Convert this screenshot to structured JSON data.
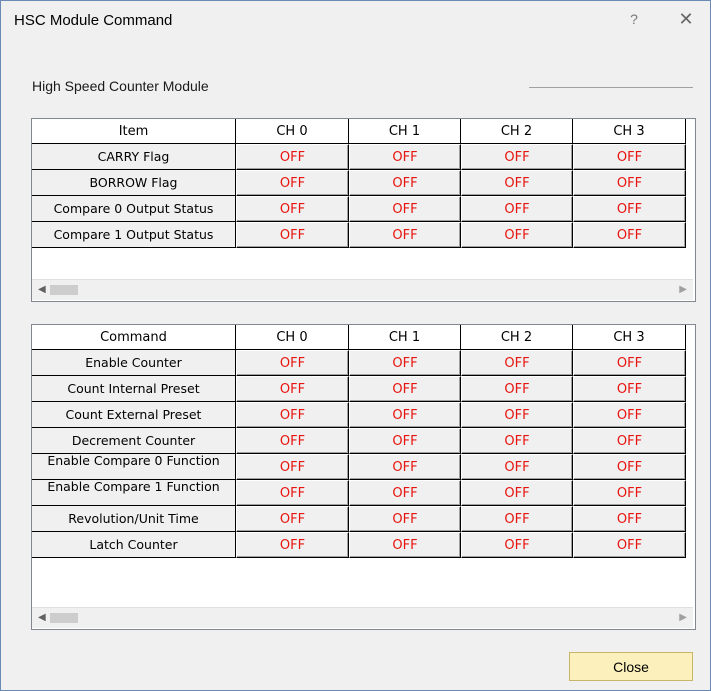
{
  "window": {
    "title": "HSC Module Command",
    "help_label": "?",
    "close_label": "✕"
  },
  "group": {
    "title": "High Speed Counter Module"
  },
  "status_grid": {
    "headers": [
      "Item",
      "CH 0",
      "CH 1",
      "CH 2",
      "CH 3"
    ],
    "rows": [
      {
        "label": "CARRY Flag",
        "values": [
          "OFF",
          "OFF",
          "OFF",
          "OFF"
        ]
      },
      {
        "label": "BORROW Flag",
        "values": [
          "OFF",
          "OFF",
          "OFF",
          "OFF"
        ]
      },
      {
        "label": "Compare 0 Output Status",
        "values": [
          "OFF",
          "OFF",
          "OFF",
          "OFF"
        ]
      },
      {
        "label": "Compare 1 Output Status",
        "values": [
          "OFF",
          "OFF",
          "OFF",
          "OFF"
        ]
      }
    ]
  },
  "command_grid": {
    "headers": [
      "Command",
      "CH 0",
      "CH 1",
      "CH 2",
      "CH 3"
    ],
    "rows": [
      {
        "label": "Enable Counter",
        "values": [
          "OFF",
          "OFF",
          "OFF",
          "OFF"
        ]
      },
      {
        "label": "Count Internal Preset",
        "values": [
          "OFF",
          "OFF",
          "OFF",
          "OFF"
        ]
      },
      {
        "label": "Count External Preset",
        "values": [
          "OFF",
          "OFF",
          "OFF",
          "OFF"
        ]
      },
      {
        "label": "Decrement Counter",
        "values": [
          "OFF",
          "OFF",
          "OFF",
          "OFF"
        ]
      },
      {
        "label": "Enable Compare 0 Function",
        "values": [
          "OFF",
          "OFF",
          "OFF",
          "OFF"
        ]
      },
      {
        "label": "Enable Compare 1 Function",
        "values": [
          "OFF",
          "OFF",
          "OFF",
          "OFF"
        ]
      },
      {
        "label": "Revolution/Unit Time",
        "values": [
          "OFF",
          "OFF",
          "OFF",
          "OFF"
        ]
      },
      {
        "label": "Latch Counter",
        "values": [
          "OFF",
          "OFF",
          "OFF",
          "OFF"
        ]
      }
    ]
  },
  "buttons": {
    "close_label": "Close"
  },
  "colors": {
    "off_text": "#e8140f",
    "close_button_bg": "#fcf1bd",
    "window_border": "#6a8ab5"
  }
}
